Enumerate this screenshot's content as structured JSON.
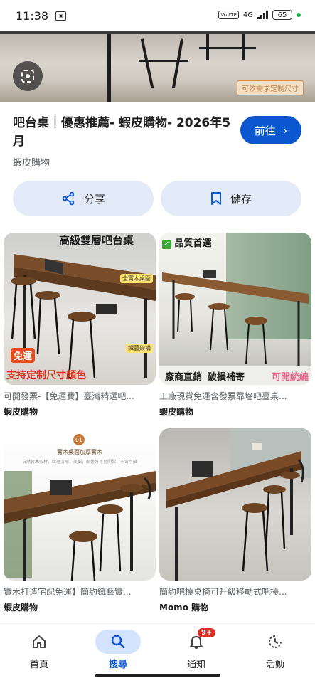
{
  "status_bar": {
    "time": "11:38",
    "network": "4G",
    "battery": "65"
  },
  "hero": {
    "badge": "可依需求定制尺寸"
  },
  "result": {
    "title": "吧台桌｜優惠推薦- 蝦皮購物- 2026年5月",
    "source": "蝦皮購物",
    "visit_label": "前往"
  },
  "actions": {
    "share_label": "分享",
    "save_label": "儲存"
  },
  "related": [
    {
      "caption": "可開發票-【免運費】臺灣精選吧...",
      "source": "蝦皮購物",
      "overlay": {
        "banner": "高級雙層吧台桌",
        "free": "免運",
        "red": "支持定制尺寸顏色",
        "tag1": "全實木桌面",
        "tag2": "鐵藝架構"
      }
    },
    {
      "caption": "工廠現貨免運含發票靠墻吧臺桌...",
      "source": "蝦皮購物",
      "overlay": {
        "quality": "品質首選",
        "foot_left": "廠商直銷",
        "foot_mid": "破損補寄",
        "foot_right": "可開統編"
      }
    },
    {
      "caption": "實木打造宅配免運】簡約鐵藝實...",
      "source": "蝦皮購物",
      "overlay": {
        "num": "01",
        "heading": "實木桌面加厚實木",
        "sub": "自然實木取材，紋理清晰，美觀，韌性好不易開裂，不含甲醛"
      }
    },
    {
      "caption": "簡約吧檯桌椅可升級移動式吧檯...",
      "source": "Momo 購物",
      "overlay": {}
    }
  ],
  "bottom_nav": {
    "items": [
      {
        "label": "首頁",
        "icon": "home-icon"
      },
      {
        "label": "搜尋",
        "icon": "search-icon"
      },
      {
        "label": "通知",
        "icon": "bell-icon",
        "badge": "9+"
      },
      {
        "label": "活動",
        "icon": "activity-icon"
      }
    ],
    "active_index": 1
  },
  "colors": {
    "accent": "#0b57d0",
    "chip_bg": "#e4ebf8",
    "active_nav_bg": "#d3e3fd",
    "badge": "#d93025"
  }
}
